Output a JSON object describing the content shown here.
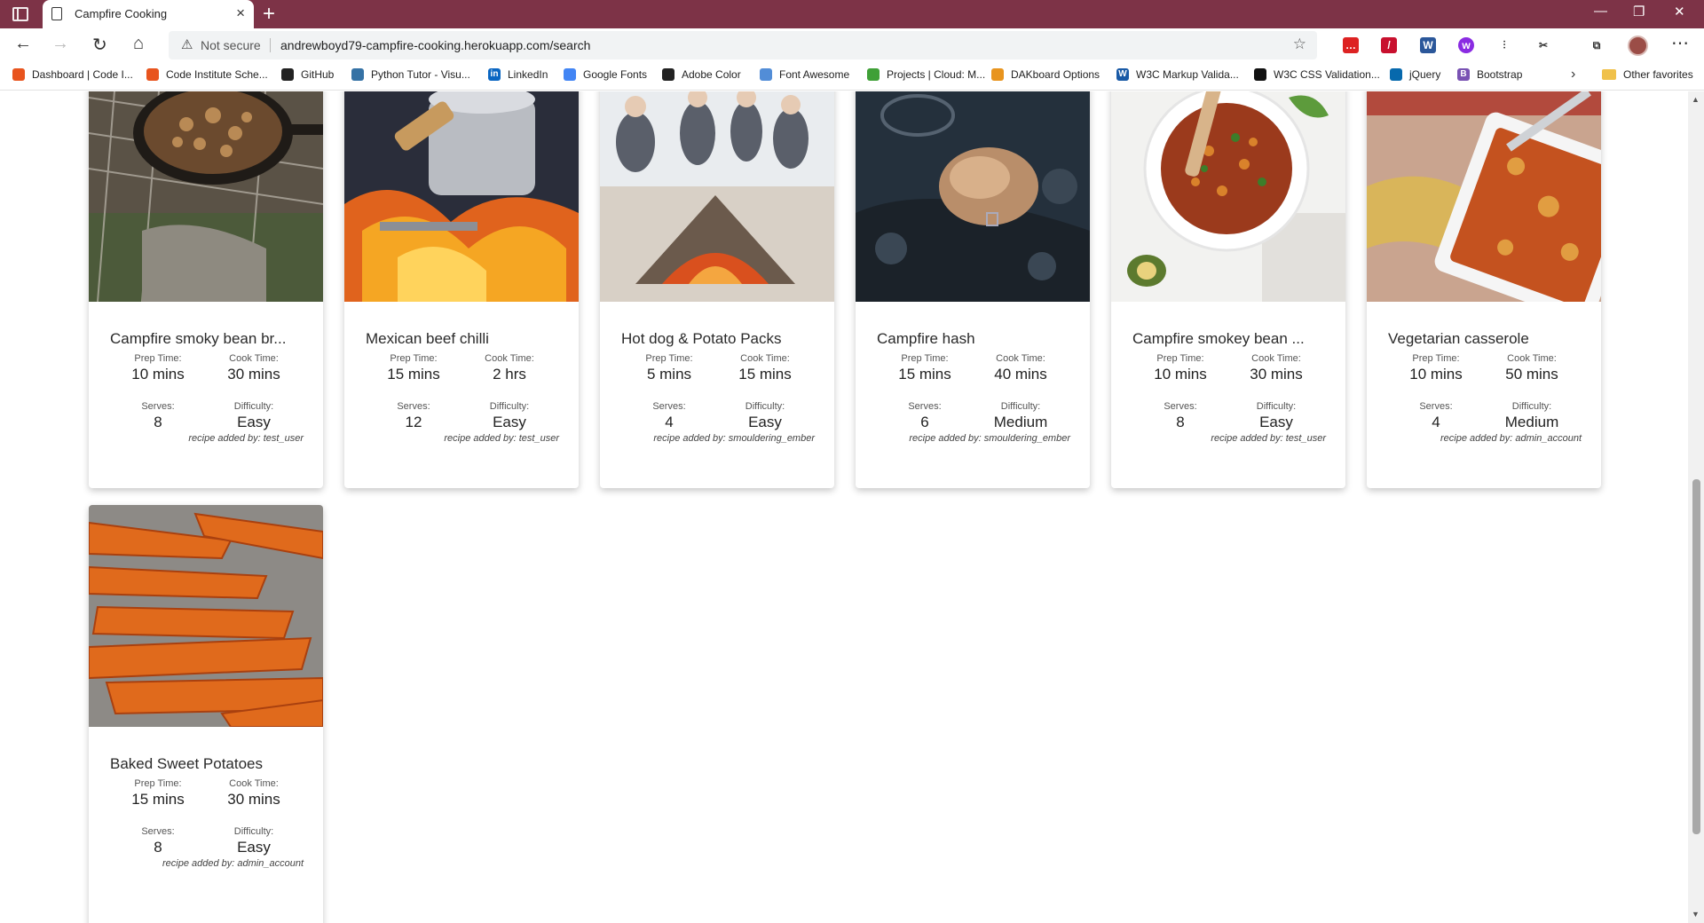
{
  "browser": {
    "tab_title": "Campfire Cooking",
    "new_tab": "+",
    "not_secure": "Not secure",
    "url": "andrewboyd79-campfire-cooking.herokuapp.com/search",
    "bookmarks": [
      {
        "label": "Dashboard | Code I...",
        "color": "#e8541e",
        "glyph": ""
      },
      {
        "label": "Code Institute Sche...",
        "color": "#e8541e",
        "glyph": ""
      },
      {
        "label": "GitHub",
        "color": "#222222",
        "glyph": ""
      },
      {
        "label": "Python Tutor - Visu...",
        "color": "#3572a5",
        "glyph": ""
      },
      {
        "label": "LinkedIn",
        "color": "#0a66c2",
        "glyph": "in"
      },
      {
        "label": "Google Fonts",
        "color": "#4285f4",
        "glyph": ""
      },
      {
        "label": "Adobe Color",
        "color": "#222222",
        "glyph": ""
      },
      {
        "label": "Font Awesome",
        "color": "#528dd7",
        "glyph": ""
      },
      {
        "label": "Projects | Cloud: M...",
        "color": "#3fa037",
        "glyph": ""
      },
      {
        "label": "DAKboard Options",
        "color": "#e8941e",
        "glyph": ""
      },
      {
        "label": "W3C Markup Valida...",
        "color": "#1a5aa6",
        "glyph": "W"
      },
      {
        "label": "W3C CSS Validation...",
        "color": "#111111",
        "glyph": ""
      },
      {
        "label": "jQuery",
        "color": "#0769ad",
        "glyph": ""
      },
      {
        "label": "Bootstrap",
        "color": "#7952b3",
        "glyph": "B"
      }
    ],
    "other_favorites": "Other favorites"
  },
  "recipes": [
    {
      "title": "Campfire smoky bean br...",
      "prep_label": "Prep Time:",
      "prep": "10 mins",
      "cook_label": "Cook Time:",
      "cook": "30 mins",
      "serves_label": "Serves:",
      "serves": "8",
      "difficulty_label": "Difficulty:",
      "difficulty": "Easy",
      "added_by": "recipe added by: test_user"
    },
    {
      "title": "Mexican beef chilli",
      "prep_label": "Prep Time:",
      "prep": "15 mins",
      "cook_label": "Cook Time:",
      "cook": "2 hrs",
      "serves_label": "Serves:",
      "serves": "12",
      "difficulty_label": "Difficulty:",
      "difficulty": "Easy",
      "added_by": "recipe added by: test_user"
    },
    {
      "title": "Hot dog & Potato Packs",
      "prep_label": "Prep Time:",
      "prep": "5 mins",
      "cook_label": "Cook Time:",
      "cook": "15 mins",
      "serves_label": "Serves:",
      "serves": "4",
      "difficulty_label": "Difficulty:",
      "difficulty": "Easy",
      "added_by": "recipe added by: smouldering_ember"
    },
    {
      "title": "Campfire hash",
      "prep_label": "Prep Time:",
      "prep": "15 mins",
      "cook_label": "Cook Time:",
      "cook": "40 mins",
      "serves_label": "Serves:",
      "serves": "6",
      "difficulty_label": "Difficulty:",
      "difficulty": "Medium",
      "added_by": "recipe added by: smouldering_ember"
    },
    {
      "title": "Campfire smokey bean ...",
      "prep_label": "Prep Time:",
      "prep": "10 mins",
      "cook_label": "Cook Time:",
      "cook": "30 mins",
      "serves_label": "Serves:",
      "serves": "8",
      "difficulty_label": "Difficulty:",
      "difficulty": "Easy",
      "added_by": "recipe added by: test_user"
    },
    {
      "title": "Vegetarian casserole",
      "prep_label": "Prep Time:",
      "prep": "10 mins",
      "cook_label": "Cook Time:",
      "cook": "50 mins",
      "serves_label": "Serves:",
      "serves": "4",
      "difficulty_label": "Difficulty:",
      "difficulty": "Medium",
      "added_by": "recipe added by: admin_account"
    },
    {
      "title": "Baked Sweet Potatoes",
      "prep_label": "Prep Time:",
      "prep": "15 mins",
      "cook_label": "Cook Time:",
      "cook": "30 mins",
      "serves_label": "Serves:",
      "serves": "8",
      "difficulty_label": "Difficulty:",
      "difficulty": "Easy",
      "added_by": "recipe added by: admin_account"
    }
  ],
  "colors": {
    "titlebar": "#7d3347"
  }
}
